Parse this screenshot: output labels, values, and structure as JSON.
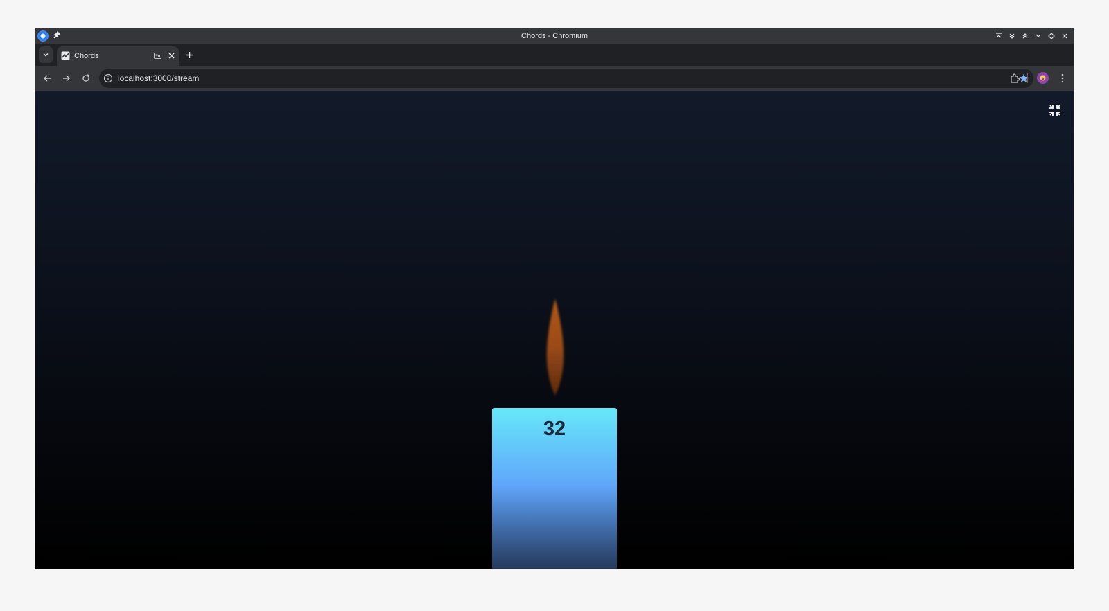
{
  "window": {
    "title": "Chords - Chromium"
  },
  "tabs": [
    {
      "label": "Chords",
      "active": true
    }
  ],
  "toolbar": {
    "url": "localhost:3000/stream",
    "bookmarked": true
  },
  "page": {
    "candle_count": "32",
    "colors": {
      "candle_top": "#67e8f9",
      "candle_mid": "#60a5fa",
      "flame": "#9a4a14",
      "background_top": "#121a2a",
      "background_bottom": "#000000"
    }
  },
  "icons": {
    "exit_fullscreen": "exit-fullscreen-icon",
    "star": "star-icon",
    "extensions": "puzzle-icon",
    "menu": "kebab-menu-icon"
  }
}
